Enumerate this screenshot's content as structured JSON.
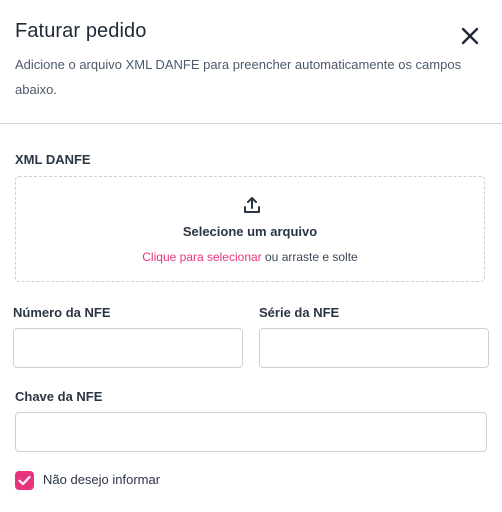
{
  "modal": {
    "title": "Faturar pedido",
    "subtitle": "Adicione o arquivo XML DANFE para preencher automaticamente os campos abaixo.",
    "close_icon": "close-icon"
  },
  "xml_danfe": {
    "label": "XML DANFE",
    "icon": "upload-icon",
    "dropzone_title": "Selecione um arquivo",
    "dropzone_link": "Clique para selecionar",
    "dropzone_rest": " ou arraste e solte"
  },
  "fields": {
    "numero_label": "Número da NFE",
    "numero_value": "",
    "serie_label": "Série da NFE",
    "serie_value": "",
    "chave_label": "Chave da NFE",
    "chave_value": ""
  },
  "checkbox": {
    "label": "Não desejo informar",
    "checked": true
  },
  "colors": {
    "accent": "#e8347f",
    "text": "#2b3644",
    "border": "#c9d0d8"
  }
}
